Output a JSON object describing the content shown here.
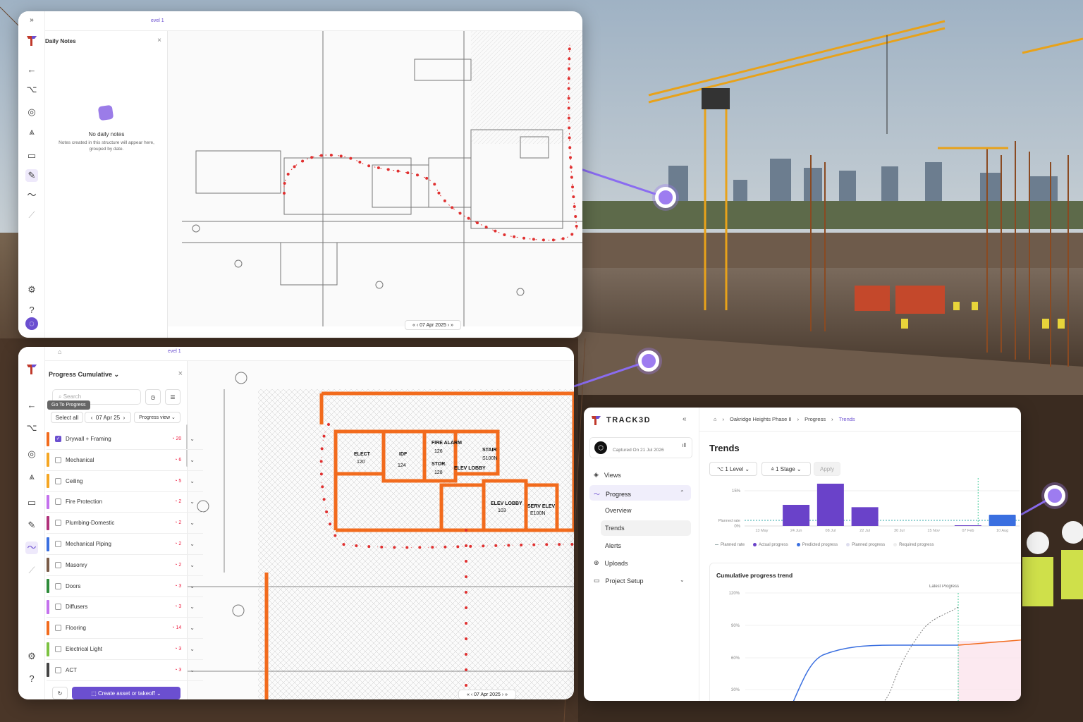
{
  "colors": {
    "accent": "#6b4fd0",
    "orange": "#f26b1d",
    "red": "#e03030",
    "actual": "#6a42c9",
    "predicted": "#3a6fe0"
  },
  "notes_panel": {
    "level_label": "evel 1",
    "title": "Daily Notes",
    "empty_title": "No daily notes",
    "empty_desc": "Notes created in this structure will appear here, grouped by date.",
    "date": "07 Apr 2025"
  },
  "progress_panel": {
    "level_label": "evel 1",
    "title": "Progress Cumulative",
    "search_placeholder": "Search",
    "tooltip": "Go To Progress",
    "select_all": "Select all",
    "date": "07 Apr 25",
    "view": "Progress view",
    "categories": [
      {
        "label": "Drywall + Framing",
        "count": "20",
        "color": "#f26b1d",
        "checked": true
      },
      {
        "label": "Mechanical",
        "count": "6",
        "color": "#f5a623",
        "checked": false
      },
      {
        "label": "Ceiling",
        "count": "5",
        "color": "#f5a623",
        "checked": false
      },
      {
        "label": "Fire Protection",
        "count": "2",
        "color": "#c471ed",
        "checked": false
      },
      {
        "label": "Plumbing-Domestic",
        "count": "2",
        "color": "#b0327a",
        "checked": false
      },
      {
        "label": "Mechanical Piping",
        "count": "2",
        "color": "#3a6fe0",
        "checked": false
      },
      {
        "label": "Masonry",
        "count": "2",
        "color": "#7a5c48",
        "checked": false
      },
      {
        "label": "Doors",
        "count": "3",
        "color": "#2e8b3a",
        "checked": false
      },
      {
        "label": "Diffusers",
        "count": "3",
        "color": "#c471ed",
        "checked": false
      },
      {
        "label": "Flooring",
        "count": "14",
        "color": "#f26b1d",
        "checked": false
      },
      {
        "label": "Electrical Light",
        "count": "3",
        "color": "#7cc242",
        "checked": false
      },
      {
        "label": "ACT",
        "count": "3",
        "color": "#444444",
        "checked": false
      }
    ],
    "create_button": "Create asset or takeoff",
    "date_footer": "07 Apr 2025",
    "rooms": [
      "ELECT",
      "120",
      "IDF",
      "124",
      "FIRE ALARM",
      "126",
      "STOR.",
      "128",
      "ELEV LOBBY",
      "STAIR",
      "S100N",
      "ELEV LOBBY",
      "103",
      "SERV ELEV",
      "E100N"
    ]
  },
  "trends_panel": {
    "brand": "TRACK3D",
    "breadcrumb": [
      "Oakridge Heights Phase II",
      "Progress",
      "Trends"
    ],
    "captured": "Captured On 21 Jul 2026",
    "nav": {
      "views": "Views",
      "progress": "Progress",
      "overview": "Overview",
      "trends": "Trends",
      "alerts": "Alerts",
      "uploads": "Uploads",
      "project_setup": "Project Setup"
    },
    "title": "Trends",
    "filters": {
      "level": "1 Level",
      "stage": "1 Stage",
      "apply": "Apply"
    },
    "legend": [
      "Planned rate",
      "Actual progress",
      "Predicted progress",
      "Planned progress",
      "Required progress"
    ],
    "cumulative_title": "Cumulative progress trend",
    "latest_label": "Latest Progress"
  },
  "chart_data": [
    {
      "type": "bar",
      "title": "",
      "categories": [
        "13 May",
        "24 Jun",
        "08 Jul",
        "22 Jul",
        "30 Jul",
        "15 Nov",
        "07 Feb",
        "10 Aug"
      ],
      "series": [
        {
          "name": "Actual progress",
          "values": [
            0,
            9,
            18,
            8,
            0,
            0,
            0.3,
            0
          ]
        },
        {
          "name": "Predicted progress",
          "values": [
            0,
            0,
            0,
            0,
            0,
            0,
            0,
            1.2
          ]
        }
      ],
      "yticks": [
        "15%",
        "0%"
      ],
      "ylim": [
        0,
        18
      ],
      "annotations": [
        "Planned rate"
      ]
    },
    {
      "type": "line",
      "title": "Cumulative progress trend",
      "yticks": [
        "120%",
        "90%",
        "60%",
        "30%"
      ],
      "ylim": [
        25,
        125
      ],
      "annotations": [
        "Latest Progress"
      ]
    }
  ]
}
